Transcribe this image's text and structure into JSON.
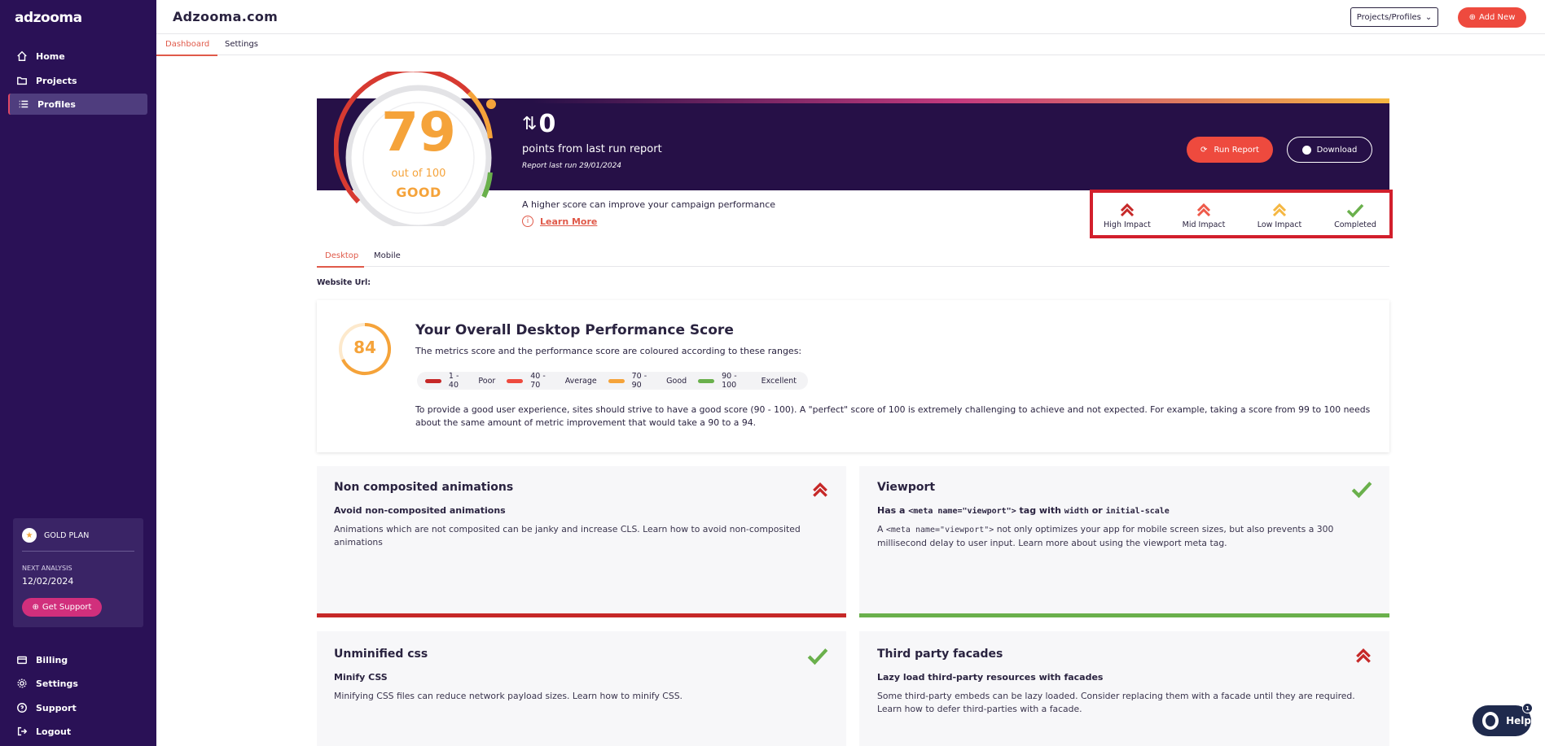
{
  "sidebar": {
    "logo": "adzooma",
    "nav": [
      {
        "label": "Home",
        "icon": "home-icon"
      },
      {
        "label": "Projects",
        "icon": "folder-icon"
      },
      {
        "label": "Profiles",
        "icon": "list-icon"
      }
    ],
    "plan": {
      "name": "GOLD PLAN",
      "next_label": "NEXT ANALYSIS",
      "next_date": "12/02/2024",
      "support": "Get Support"
    },
    "bottom": [
      {
        "label": "Billing",
        "icon": "card-icon"
      },
      {
        "label": "Settings",
        "icon": "gear-icon"
      },
      {
        "label": "Support",
        "icon": "question-icon"
      },
      {
        "label": "Logout",
        "icon": "logout-icon"
      }
    ]
  },
  "header": {
    "title": "Adzooma.com",
    "projects_button": "Projects/Profiles",
    "add_button": "Add New",
    "tabs": [
      "Dashboard",
      "Settings"
    ]
  },
  "hero": {
    "score": "79",
    "out_of": "out of 100",
    "rating": "GOOD",
    "delta": "0",
    "points_text": "points from last run report",
    "last_run": "Report last run 29/01/2024",
    "run_button": "Run Report",
    "download_button": "Download",
    "hint": "A higher score can improve your campaign performance",
    "learn_more": "Learn More"
  },
  "impact_legend": [
    "High Impact",
    "Mid Impact",
    "Low Impact",
    "Completed"
  ],
  "device_tabs": [
    "Desktop",
    "Mobile"
  ],
  "website_url_label": "Website Url:",
  "overall": {
    "score": "84",
    "title": "Your Overall Desktop Performance Score",
    "subtitle": "The metrics score and the performance score are coloured according to these ranges:",
    "ranges": [
      {
        "range": "1 - 40",
        "label": "Poor",
        "color": "#c62828"
      },
      {
        "range": "40 - 70",
        "label": "Average",
        "color": "#ee4a3e"
      },
      {
        "range": "70 - 90",
        "label": "Good",
        "color": "#f5a33a"
      },
      {
        "range": "90 - 100",
        "label": "Excellent",
        "color": "#6ab04c"
      }
    ],
    "paragraph": "To provide a good user experience, sites should strive to have a good score (90 - 100). A \"perfect\" score of 100 is extremely challenging to achieve and not expected. For example, taking a score from 99 to 100 needs about the same amount of metric improvement that would take a 90 to a 94."
  },
  "audits": [
    {
      "title": "Non composited animations",
      "subtitle": "Avoid non-composited animations",
      "description": "Animations which are not composited can be janky and increase CLS. Learn how to avoid non-composited animations",
      "status": "high",
      "bar_color": "#c62828"
    },
    {
      "title": "Viewport",
      "subtitle_parts": [
        "Has a ",
        "<meta name=\"viewport\">",
        " tag with ",
        "width",
        " or ",
        "initial-scale"
      ],
      "description_parts": [
        "A ",
        "<meta name=\"viewport\">",
        " not only optimizes your app for mobile screen sizes, but also prevents a 300 millisecond delay to user input. Learn more about using the viewport meta tag."
      ],
      "status": "completed",
      "bar_color": "#6ab04c"
    },
    {
      "title": "Unminified css",
      "subtitle": "Minify CSS",
      "description": "Minifying CSS files can reduce network payload sizes. Learn how to minify CSS.",
      "status": "completed"
    },
    {
      "title": "Third party facades",
      "subtitle": "Lazy load third-party resources with facades",
      "description": "Some third-party embeds can be lazy loaded. Consider replacing them with a facade until they are required. Learn how to defer third-parties with a facade.",
      "status": "high"
    }
  ],
  "help": {
    "label": "Help",
    "badge": "1"
  }
}
